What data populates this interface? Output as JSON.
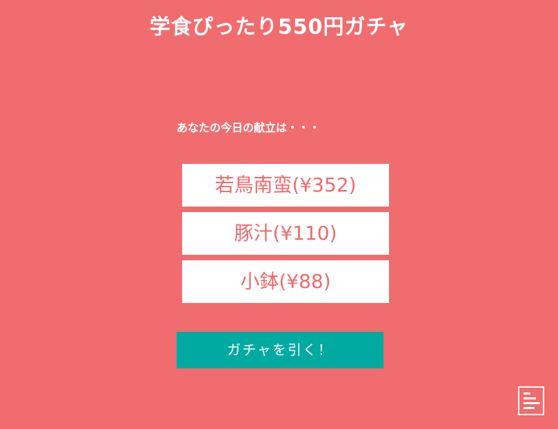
{
  "header": {
    "title": "学食ぴったり550円ガチャ"
  },
  "intro": {
    "text": "あなたの今日の献立は・・・"
  },
  "results": [
    {
      "label": "若鳥南蛮(¥352)"
    },
    {
      "label": "豚汁(¥110)"
    },
    {
      "label": "小鉢(¥88)"
    }
  ],
  "actions": {
    "gacha_label": "ガチャを引く！"
  },
  "icons": {
    "menu": "document-lines-icon"
  },
  "colors": {
    "background": "#f06c6e",
    "card_text": "#ee6a6c",
    "button": "#00aaa1",
    "white": "#ffffff"
  }
}
